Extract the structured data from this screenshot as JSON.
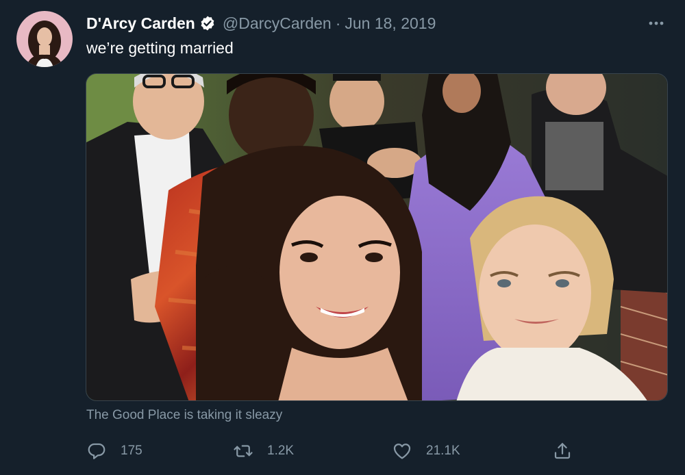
{
  "author": {
    "display_name": "D'Arcy Carden",
    "handle": "@DarcyCarden",
    "separator": "·",
    "date": "Jun 18, 2019",
    "verified": true
  },
  "tweet": {
    "text": "we’re getting married",
    "media_caption": "The Good Place is taking it sleazy"
  },
  "actions": {
    "reply_count": "175",
    "retweet_count": "1.2K",
    "like_count": "21.1K"
  },
  "icons": {
    "verified": "verified-badge-icon",
    "more": "more-options-icon",
    "reply": "reply-icon",
    "retweet": "retweet-icon",
    "like": "heart-icon",
    "share": "share-icon"
  },
  "colors": {
    "background": "#15202b",
    "secondary_text": "#8899a6",
    "primary_text": "#ffffff"
  }
}
